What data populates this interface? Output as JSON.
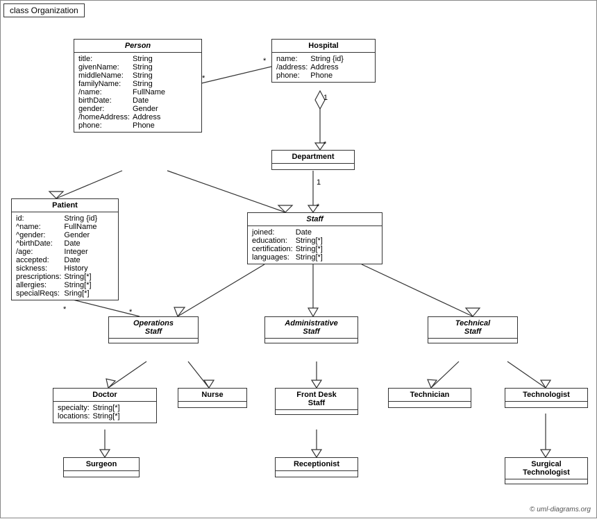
{
  "title": "class Organization",
  "classes": {
    "person": {
      "name": "Person",
      "italic": true,
      "fields": [
        [
          "title:",
          "String"
        ],
        [
          "givenName:",
          "String"
        ],
        [
          "middleName:",
          "String"
        ],
        [
          "familyName:",
          "String"
        ],
        [
          "/name:",
          "FullName"
        ],
        [
          "birthDate:",
          "Date"
        ],
        [
          "gender:",
          "Gender"
        ],
        [
          "/homeAddress:",
          "Address"
        ],
        [
          "phone:",
          "Phone"
        ]
      ]
    },
    "hospital": {
      "name": "Hospital",
      "italic": false,
      "fields": [
        [
          "name:",
          "String {id}"
        ],
        [
          "/address:",
          "Address"
        ],
        [
          "phone:",
          "Phone"
        ]
      ]
    },
    "patient": {
      "name": "Patient",
      "italic": false,
      "fields": [
        [
          "id:",
          "String {id}"
        ],
        [
          "^name:",
          "FullName"
        ],
        [
          "^gender:",
          "Gender"
        ],
        [
          "^birthDate:",
          "Date"
        ],
        [
          "/age:",
          "Integer"
        ],
        [
          "accepted:",
          "Date"
        ],
        [
          "sickness:",
          "History"
        ],
        [
          "prescriptions:",
          "String[*]"
        ],
        [
          "allergies:",
          "String[*]"
        ],
        [
          "specialReqs:",
          "Sring[*]"
        ]
      ]
    },
    "department": {
      "name": "Department",
      "italic": false,
      "fields": []
    },
    "staff": {
      "name": "Staff",
      "italic": true,
      "fields": [
        [
          "joined:",
          "Date"
        ],
        [
          "education:",
          "String[*]"
        ],
        [
          "certification:",
          "String[*]"
        ],
        [
          "languages:",
          "String[*]"
        ]
      ]
    },
    "operationsStaff": {
      "name": "Operations\nStaff",
      "italic": true,
      "fields": []
    },
    "administrativeStaff": {
      "name": "Administrative\nStaff",
      "italic": true,
      "fields": []
    },
    "technicalStaff": {
      "name": "Technical\nStaff",
      "italic": true,
      "fields": []
    },
    "doctor": {
      "name": "Doctor",
      "italic": false,
      "fields": [
        [
          "specialty:",
          "String[*]"
        ],
        [
          "locations:",
          "String[*]"
        ]
      ]
    },
    "nurse": {
      "name": "Nurse",
      "italic": false,
      "fields": []
    },
    "frontDeskStaff": {
      "name": "Front Desk\nStaff",
      "italic": false,
      "fields": []
    },
    "technician": {
      "name": "Technician",
      "italic": false,
      "fields": []
    },
    "technologist": {
      "name": "Technologist",
      "italic": false,
      "fields": []
    },
    "surgeon": {
      "name": "Surgeon",
      "italic": false,
      "fields": []
    },
    "receptionist": {
      "name": "Receptionist",
      "italic": false,
      "fields": []
    },
    "surgicalTechnologist": {
      "name": "Surgical\nTechnologist",
      "italic": false,
      "fields": []
    }
  },
  "labels": {
    "multiplicity_star": "*",
    "multiplicity_1": "1",
    "copyright": "© uml-diagrams.org"
  }
}
